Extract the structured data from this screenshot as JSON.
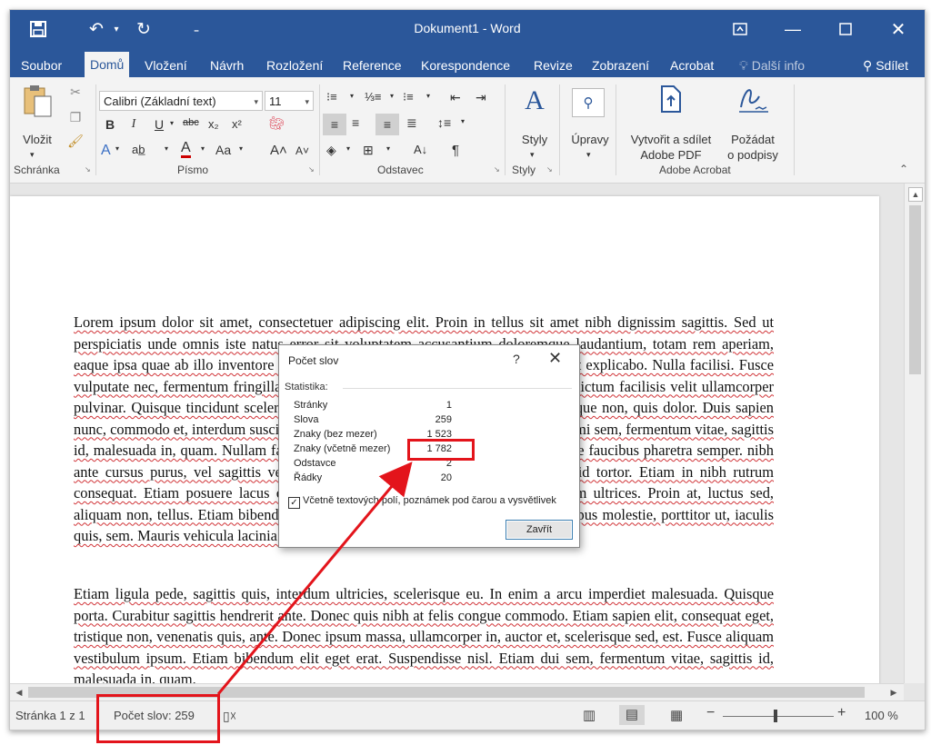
{
  "window": {
    "title": "Dokument1 - Word"
  },
  "tabs": [
    {
      "label": "Soubor"
    },
    {
      "label": "Domů"
    },
    {
      "label": "Vložení"
    },
    {
      "label": "Návrh"
    },
    {
      "label": "Rozložení"
    },
    {
      "label": "Reference"
    },
    {
      "label": "Korespondence"
    },
    {
      "label": "Revize"
    },
    {
      "label": "Zobrazení"
    },
    {
      "label": "Acrobat"
    },
    {
      "label": "Další info"
    }
  ],
  "share_label": "Sdílet",
  "ribbon": {
    "clipboard": {
      "paste_label": "Vložit",
      "group_label": "Schránka"
    },
    "font": {
      "font_name": "Calibri (Základní text)",
      "font_size": "11",
      "group_label": "Písmo",
      "change_case": "Aa"
    },
    "paragraph": {
      "group_label": "Odstavec"
    },
    "styles": {
      "label": "Styly",
      "group_label": "Styly"
    },
    "editing": {
      "label": "Úpravy"
    },
    "acrobat": {
      "create_pdf_line1": "Vytvořit a sdílet",
      "create_pdf_line2": "Adobe PDF",
      "sign_line1": "Požádat",
      "sign_line2": "o podpisy",
      "group_label": "Adobe Acrobat"
    }
  },
  "document": {
    "paragraph1": "Lorem ipsum dolor sit amet, consectetuer adipiscing elit. Proin in tellus sit amet nibh dignissim sagittis. Sed ut perspiciatis unde omnis iste natus error sit voluptatem accusantium doloremque laudantium, totam rem aperiam, eaque ipsa quae ab illo inventore veritatis et quasi architecto beatae vitae dicta sunt explicabo. Nulla facilisi. Fusce vulputate nec, fermentum fringilla, vehicula vitae, justo. Nulla quis diam. Mauris dictum facilisis velit ullamcorper pulvinar. Quisque tincidunt scelerisque libero. Morbi leo mi, nonummy eget, tristique non, quis dolor. Duis sapien nunc, commodo et, interdum suscipit, sollicitudin et, dolor. Nam quis nulla. Integer mi sem, fermentum vitae, sagittis id, malesuada in, quam. Nullam faucibus mi quis velit. Nulla non arcu lacinia neque faucibus pharetra semper. nibh ante cursus purus, vel sagittis velit mauris vel metus. Aenean fermentum risus id tortor. Etiam in nibh rutrum consequat. Etiam posuere lacus quis dolor. Praesent id justo in neque elementum ultrices. Proin at, luctus sed, aliquam non, tellus. Etiam bibendum elit eget erat. Sed vel lectus. Donec odio tempus molestie, porttitor ut, iaculis quis, sem. Mauris vehicula lacinia. In convallis. Proin mattis lacinia justo.",
    "paragraph2": "Etiam ligula pede, sagittis quis, interdum ultricies, scelerisque eu. In enim a arcu imperdiet malesuada. Quisque porta. Curabitur sagittis hendrerit ante. Donec quis nibh at felis congue commodo. Etiam sapien elit, consequat eget, tristique non, venenatis quis, ante. Donec ipsum massa, ullamcorper in, auctor et, scelerisque sed, est. Fusce aliquam vestibulum ipsum. Etiam bibendum elit eget erat. Suspendisse nisl. Etiam dui sem, fermentum vitae, sagittis id, malesuada in, quam."
  },
  "dialog": {
    "title": "Počet slov",
    "help": "?",
    "section": "Statistika:",
    "stats": [
      {
        "label": "Stránky",
        "value": "1"
      },
      {
        "label": "Slova",
        "value": "259"
      },
      {
        "label": "Znaky (bez mezer)",
        "value": "1 523"
      },
      {
        "label": "Znaky (včetně mezer)",
        "value": "1 782"
      },
      {
        "label": "Odstavce",
        "value": "2"
      },
      {
        "label": "Řádky",
        "value": "20"
      }
    ],
    "checkbox_label": "Včetně textových polí, poznámek pod čarou a vysvětlivek",
    "checkbox_checked": true,
    "close_label": "Zavřít"
  },
  "statusbar": {
    "page": "Stránka 1 z 1",
    "word_count": "Počet slov: 259",
    "zoom": "100 %"
  },
  "colors": {
    "title_bar": "#2b579a",
    "annotation": "#e3141b"
  }
}
